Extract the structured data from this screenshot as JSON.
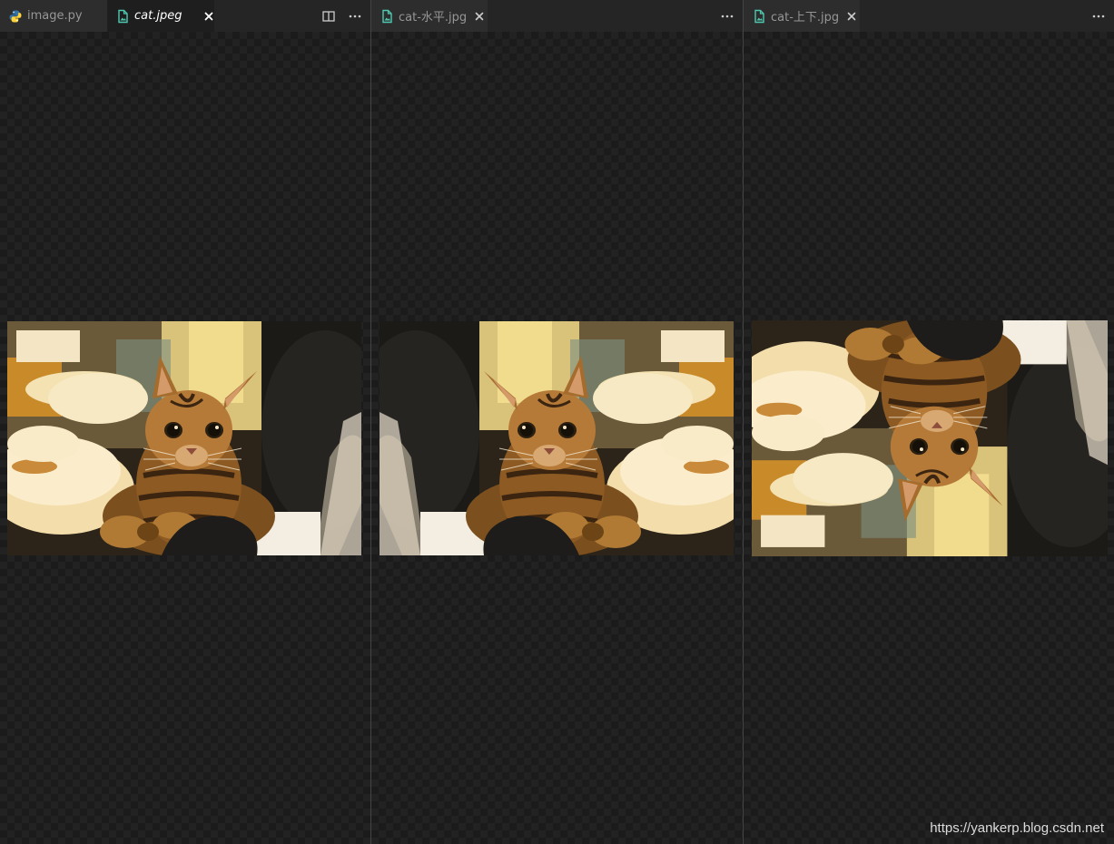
{
  "groups": [
    {
      "tabs": [
        {
          "label": "image.py",
          "icon": "python-icon",
          "active": false
        },
        {
          "label": "cat.jpeg",
          "icon": "image-file-icon",
          "active": true
        }
      ],
      "actions": [
        "split-editor-icon",
        "more-actions-icon"
      ],
      "image": {
        "alt": "cat",
        "transform": "original"
      }
    },
    {
      "tabs": [
        {
          "label": "cat-水平.jpg",
          "icon": "image-file-icon",
          "active": false
        }
      ],
      "actions": [
        "more-actions-icon"
      ],
      "image": {
        "alt": "cat",
        "transform": "flip-horizontal"
      }
    },
    {
      "tabs": [
        {
          "label": "cat-上下.jpg",
          "icon": "image-file-icon",
          "active": false
        }
      ],
      "actions": [
        "more-actions-icon"
      ],
      "image": {
        "alt": "cat",
        "transform": "flip-vertical"
      }
    }
  ],
  "watermark": "https://yankerp.blog.csdn.net",
  "colors": {
    "background": "#1e1e1e",
    "tab_inactive_bg": "#2d2d2d",
    "tab_active_text": "#ffffff",
    "tab_inactive_text": "#969696",
    "image_file_icon": "#4ec9b0",
    "python_blue": "#3572a5",
    "python_yellow": "#ffd43b"
  }
}
